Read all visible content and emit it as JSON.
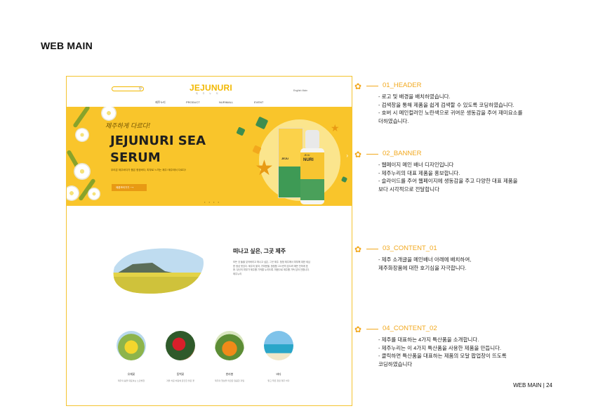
{
  "page_title": "WEB MAIN",
  "footer_label": "WEB MAIN | 24",
  "mockup": {
    "header": {
      "search_icon": "magnifier-icon",
      "logo": "JEJUNURI",
      "logo_sub": "제 주 누 리",
      "util_links": "English   Main",
      "nav": [
        "제주누리",
        "PRODUCT",
        "NURIMALL",
        "EVENT"
      ]
    },
    "banner": {
      "script_text": "제주하게 다르다!",
      "title_line1": "JEJUNURI SEA",
      "title_line2": "SERUM",
      "desc": "우리은 제주바다가 품은 청정바다, 피부로 느끼는 제주! 제주에서 다르다!",
      "button_label": "제품보러가기  ⟶",
      "dots": "• • • •",
      "box_label": "JEJU",
      "bottle_label_top": "JEJU",
      "bottle_label": "NURI",
      "next_arrow": "›"
    },
    "content1": {
      "title": "떠나고 싶은, 그곳 제주",
      "text": "모든 것 들을 잊어버리고 떠나고 싶은, 그곳 제주. 청정 제주에서 피부에 대한 세심한 정성 멋있다. 제주의 꽃과, 귀여운을, 청정함 고스란히 담으려 애쓴 전하게 표현. 당신의 피부가 제주를 기억할 누리도록. 마음으로 제주를 가득 담아 전합니다. 제주누리"
    },
    "content2": {
      "items": [
        {
          "name": "유채꽃",
          "desc": "제주의 봄을 대표하는 노란빛깔"
        },
        {
          "name": "동백꽃",
          "desc": "겨울 차운 바람에 굳건한 붉은 꽃"
        },
        {
          "name": "한라봉",
          "desc": "제주의 햇살을 머금은 달콤한 과일"
        },
        {
          "name": "바다",
          "desc": "맑고 푸른 청정 제주 바다"
        }
      ]
    }
  },
  "annotations": [
    {
      "title": "01_HEADER",
      "lines": [
        "- 로고 및 배경을 배치하였습니다.",
        "- 검색창을 통해 제품을 쉽게 검색할 수 있도록 코딩하였습니다.",
        "- 호버 시  메인컬러인 노란색으로 귀여운 생동감을 주어 재미요소를",
        "   더하였습니다."
      ]
    },
    {
      "title": "02_BANNER",
      "lines": [
        "- 웹페이지 메인 배너 디자인입니다",
        "- 제주누리의 대표 제품을 홍보합니다.",
        "- 슬라이드를 주어 웹페이지에 생동감을 주고 다양한 대표 제품을",
        "   보다 시각적으로 전달합니다"
      ]
    },
    {
      "title": "03_CONTENT_01",
      "lines": [
        "- 제주 소개글을 메인배너 아래에 배치하여,",
        "  제주화장품에 대한 호기심을 자극합니다."
      ]
    },
    {
      "title": "04_CONTENT_02",
      "lines": [
        "- 제주를 대표하는 4가지 특산품을  소개합니다.",
        "- 제주누리는 이 4가지 특산품을 사용한 제품을 만듭니다.",
        "- 클릭하면 특산품을 대표하는 제품의 모달 팝업창이 뜨도록",
        "  코딩하였습니다"
      ]
    }
  ],
  "colors": {
    "accent_yellow": "#f9c52b",
    "accent_orange": "#f2a81d",
    "accent_green": "#3e9a55",
    "frame_border": "#f4c430"
  }
}
